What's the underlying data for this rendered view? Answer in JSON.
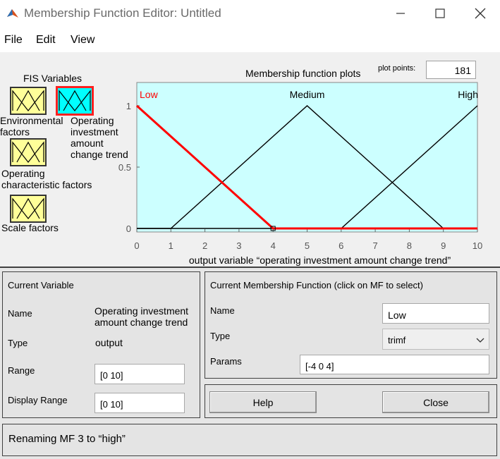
{
  "window": {
    "title": "Membership Function Editor: Untitled",
    "icons": {
      "app": "matlab-icon",
      "minimize": "minimize-icon",
      "maximize": "maximize-icon",
      "close": "close-icon"
    }
  },
  "menu": {
    "items": [
      "File",
      "Edit",
      "View"
    ]
  },
  "fis": {
    "title": "FIS Variables",
    "variables": [
      {
        "label": "Environmental factors",
        "line1": "Environmental",
        "line2": "factors",
        "kind": "input"
      },
      {
        "label": "Operating investment amount change trend",
        "line1": "Operating",
        "line2": "investment",
        "line3": "amount",
        "line4": "change trend",
        "kind": "output",
        "selected": true
      },
      {
        "label": "Operating characteristic factors",
        "line1": "Operating",
        "line2": "characteristic factors",
        "kind": "input"
      },
      {
        "label": "Scale factors",
        "line1": "Scale factors",
        "kind": "input"
      }
    ]
  },
  "plot": {
    "title": "Membership function plots",
    "plot_points_label": "plot points:",
    "plot_points_value": "181"
  },
  "chart_data": {
    "type": "line",
    "title": "Membership function plots",
    "xlabel": "output variable “operating investment amount change trend”",
    "ylabel": "",
    "xlim": [
      0,
      10
    ],
    "ylim": [
      0,
      1
    ],
    "x_ticks": [
      "0",
      "1",
      "2",
      "3",
      "4",
      "5",
      "6",
      "7",
      "8",
      "9",
      "10"
    ],
    "y_ticks": [
      "0",
      "0.5",
      "1"
    ],
    "background": "#ccffff",
    "series": [
      {
        "name": "Low",
        "x": [
          0,
          4,
          10
        ],
        "y": [
          1,
          0,
          0
        ],
        "color": "#ff0000",
        "selected": true
      },
      {
        "name": "Medium",
        "x": [
          0,
          1,
          5,
          9,
          10
        ],
        "y": [
          0,
          0,
          1,
          0,
          0
        ],
        "color": "#000000"
      },
      {
        "name": "High",
        "x": [
          0,
          6,
          10
        ],
        "y": [
          0,
          0,
          1
        ],
        "color": "#000000"
      }
    ],
    "mf_labels": [
      {
        "text": "Low",
        "x": 0,
        "color": "#ff0000"
      },
      {
        "text": "Medium",
        "x": 5,
        "color": "#000000"
      },
      {
        "text": "High",
        "x": 10,
        "color": "#000000"
      }
    ]
  },
  "current_variable": {
    "heading": "Current Variable",
    "name_label": "Name",
    "name_line1": "Operating investment",
    "name_line2": "amount change trend",
    "type_label": "Type",
    "type_value": "output",
    "range_label": "Range",
    "range_value": "[0 10]",
    "display_range_label": "Display Range",
    "display_range_value": "[0 10]"
  },
  "current_mf": {
    "heading": "Current Membership Function (click on MF to select)",
    "name_label": "Name",
    "name_value": "Low",
    "type_label": "Type",
    "type_value": "trimf",
    "params_label": "Params",
    "params_value": "[-4 0 4]"
  },
  "buttons": {
    "help": "Help",
    "close": "Close"
  },
  "status": {
    "text": "Renaming MF 3 to “high”"
  },
  "colors": {
    "selected_mf": "#ff0000",
    "plot_background": "#ccffff",
    "variable_icon": "#ffff99",
    "selected_variable_icon": "#00ffff"
  }
}
